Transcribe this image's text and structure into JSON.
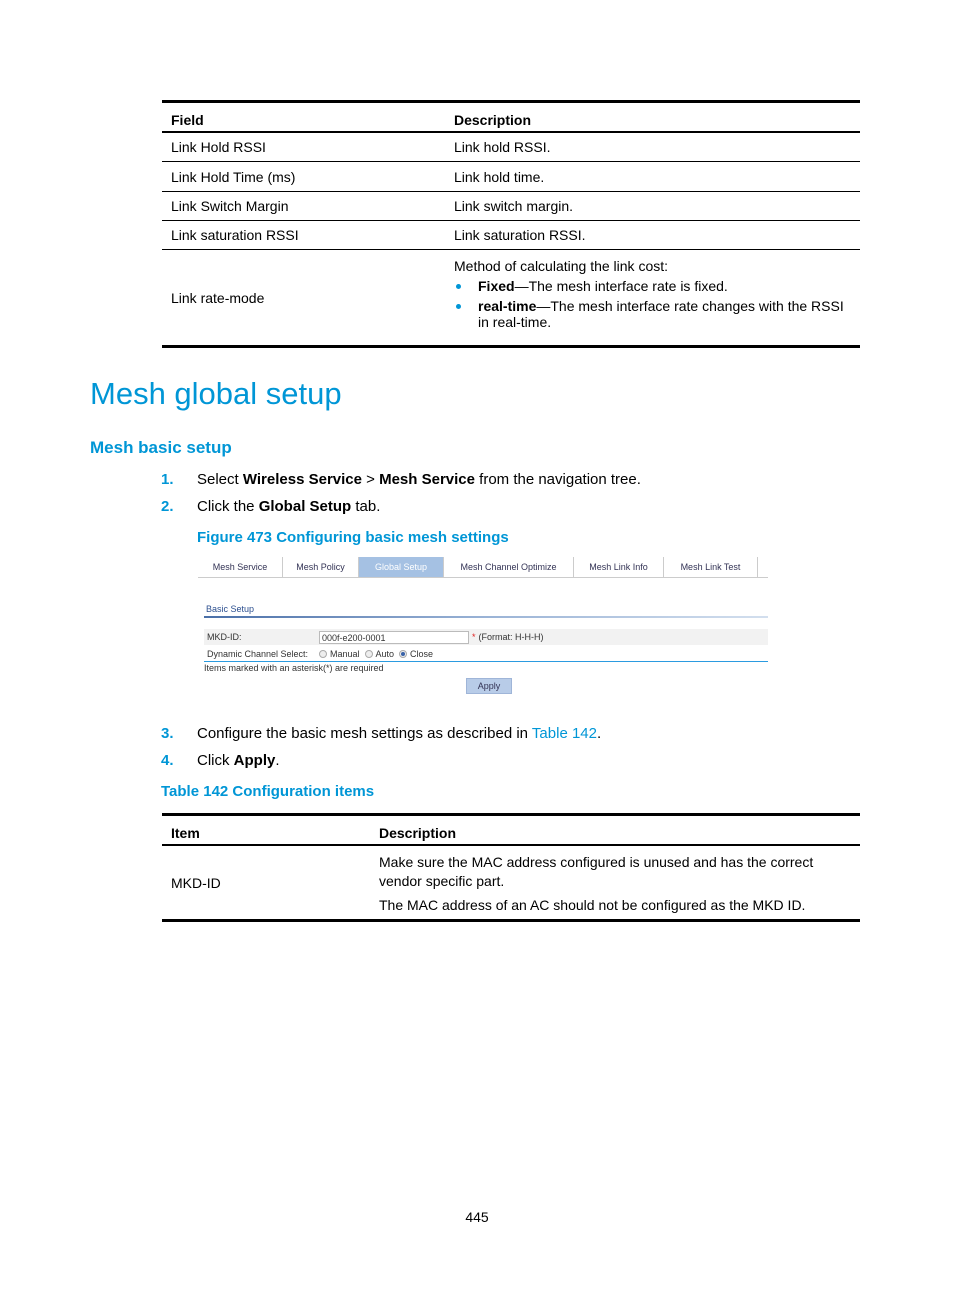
{
  "table_top": {
    "headers": [
      "Field",
      "Description"
    ],
    "rows": [
      {
        "field": "Link Hold RSSI",
        "description": "Link hold RSSI."
      },
      {
        "field": "Link Hold Time (ms)",
        "description": "Link hold time."
      },
      {
        "field": "Link Switch Margin",
        "description": "Link switch margin."
      },
      {
        "field": "Link saturation RSSI",
        "description": "Link saturation RSSI."
      }
    ],
    "rate_mode": {
      "field": "Link rate-mode",
      "intro": "Method of calculating the link cost:",
      "bullets": [
        {
          "term": "Fixed",
          "text": "—The mesh interface rate is fixed."
        },
        {
          "term": "real-time",
          "text": "—The mesh interface rate changes with the RSSI in real-time."
        }
      ]
    }
  },
  "heading": "Mesh global setup",
  "subheading": "Mesh basic setup",
  "steps": [
    {
      "num": "1.",
      "pre": "Select ",
      "b1": "Wireless Service",
      "mid": " > ",
      "b2": "Mesh Service",
      "post": " from the navigation tree."
    },
    {
      "num": "2.",
      "pre": "Click the ",
      "b1": "Global Setup",
      "post": " tab."
    },
    {
      "num": "3.",
      "pre": "Configure the basic mesh settings as described in ",
      "link": "Table 142",
      "post": "."
    },
    {
      "num": "4.",
      "pre": "Click ",
      "b1": "Apply",
      "post": "."
    }
  ],
  "figure": {
    "caption": "Figure 473 Configuring basic mesh settings",
    "tabs": [
      "Mesh Service",
      "Mesh Policy",
      "Global Setup",
      "Mesh Channel Optimize",
      "Mesh Link Info",
      "Mesh Link Test"
    ],
    "active_tab": "Global Setup",
    "section_title": "Basic Setup",
    "mkd_label": "MKD-ID:",
    "mkd_value": "000f-e200-0001",
    "required_mark": "*",
    "format_hint": "(Format:  H-H-H)",
    "channel_label": "Dynamic Channel Select:",
    "channel_options": [
      "Manual",
      "Auto",
      "Close"
    ],
    "channel_selected": "Close",
    "required_note": "Items marked with an asterisk(*) are required",
    "apply_label": "Apply"
  },
  "table_caption": "Table 142 Configuration items",
  "table_bottom": {
    "headers": [
      "Item",
      "Description"
    ],
    "rows": [
      {
        "item": "MKD-ID",
        "desc1": "Make sure the MAC address configured is unused and has the correct vendor specific part.",
        "desc2": "The MAC address of an AC should not be configured as the MKD ID."
      }
    ]
  },
  "page_number": "445"
}
